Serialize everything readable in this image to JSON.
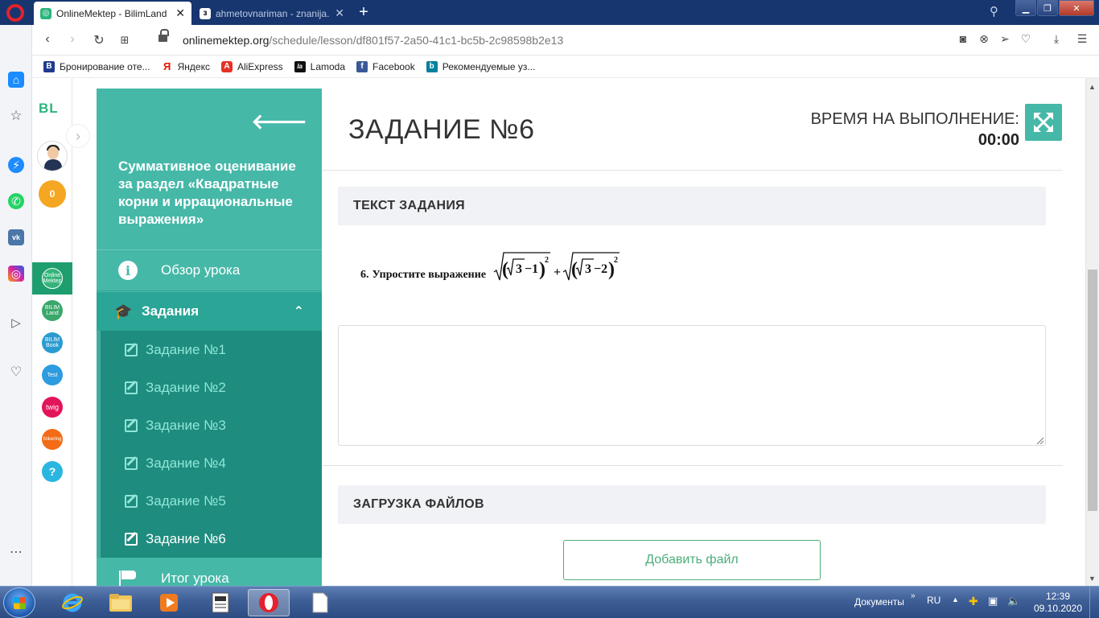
{
  "browser": {
    "tabs": [
      {
        "title": "OnlineMektep - BilimLand",
        "active": true
      },
      {
        "title": "ahmetovnariman - znanija.",
        "active": false
      }
    ],
    "url_host": "onlinemektep.org",
    "url_path": "/schedule/lesson/df801f57-2a50-41c1-bc5b-2c98598b2e13",
    "bookmarks": [
      {
        "label": "Бронирование оте...",
        "icon_letter": "B",
        "color": "#1f3b8f"
      },
      {
        "label": "Яндекс",
        "icon_letter": "Я",
        "color": "#ffffff"
      },
      {
        "label": "AliExpress",
        "icon_letter": "A",
        "color": "#e43225"
      },
      {
        "label": "Lamoda",
        "icon_letter": "la",
        "color": "#111111"
      },
      {
        "label": "Facebook",
        "icon_letter": "f",
        "color": "#3b5998"
      },
      {
        "label": "Рекомендуемые уз...",
        "icon_letter": "b",
        "color": "#00809d"
      }
    ]
  },
  "site_strip": {
    "logo": "BL",
    "coins": "0",
    "apps": [
      {
        "name": "online-mektep",
        "label": "Online Mektep",
        "color": "#34b37a"
      },
      {
        "name": "bilimland",
        "label": "BILIM Land",
        "color": "#3aa76b"
      },
      {
        "name": "bilimbook",
        "label": "BILIM Book",
        "color": "#2a9bd0"
      },
      {
        "name": "test",
        "label": "Test",
        "color": "#2d9be0"
      },
      {
        "name": "twig",
        "label": "twig",
        "color": "#e4145a"
      },
      {
        "name": "tinkering",
        "label": "tinkering",
        "color": "#f26b16"
      },
      {
        "name": "help",
        "label": "?",
        "color": "#2ab6e0"
      }
    ]
  },
  "lesson_nav": {
    "title": "Суммативное оценивание за раздел «Квадратные корни и иррациональные выражения»",
    "overview": "Обзор урока",
    "tasks_header": "Задания",
    "tasks": [
      "Задание №1",
      "Задание №2",
      "Задание №3",
      "Задание №4",
      "Задание №5",
      "Задание №6"
    ],
    "current_task_index": 5,
    "summary": "Итог урока"
  },
  "task": {
    "heading": "ЗАДАНИЕ №6",
    "timer_label": "ВРЕМЯ НА ВЫПОЛНЕНИЕ:",
    "timer_value": "00:00",
    "text_section": "ТЕКСТ ЗАДАНИЯ",
    "problem_number": "6.",
    "problem_text": "Упростите выражение",
    "upload_section": "ЗАГРУЗКА ФАЙЛОВ",
    "add_file": "Добавить файл"
  },
  "taskbar": {
    "documents": "Документы",
    "lang": "RU",
    "time": "12:39",
    "date": "09.10.2020"
  }
}
